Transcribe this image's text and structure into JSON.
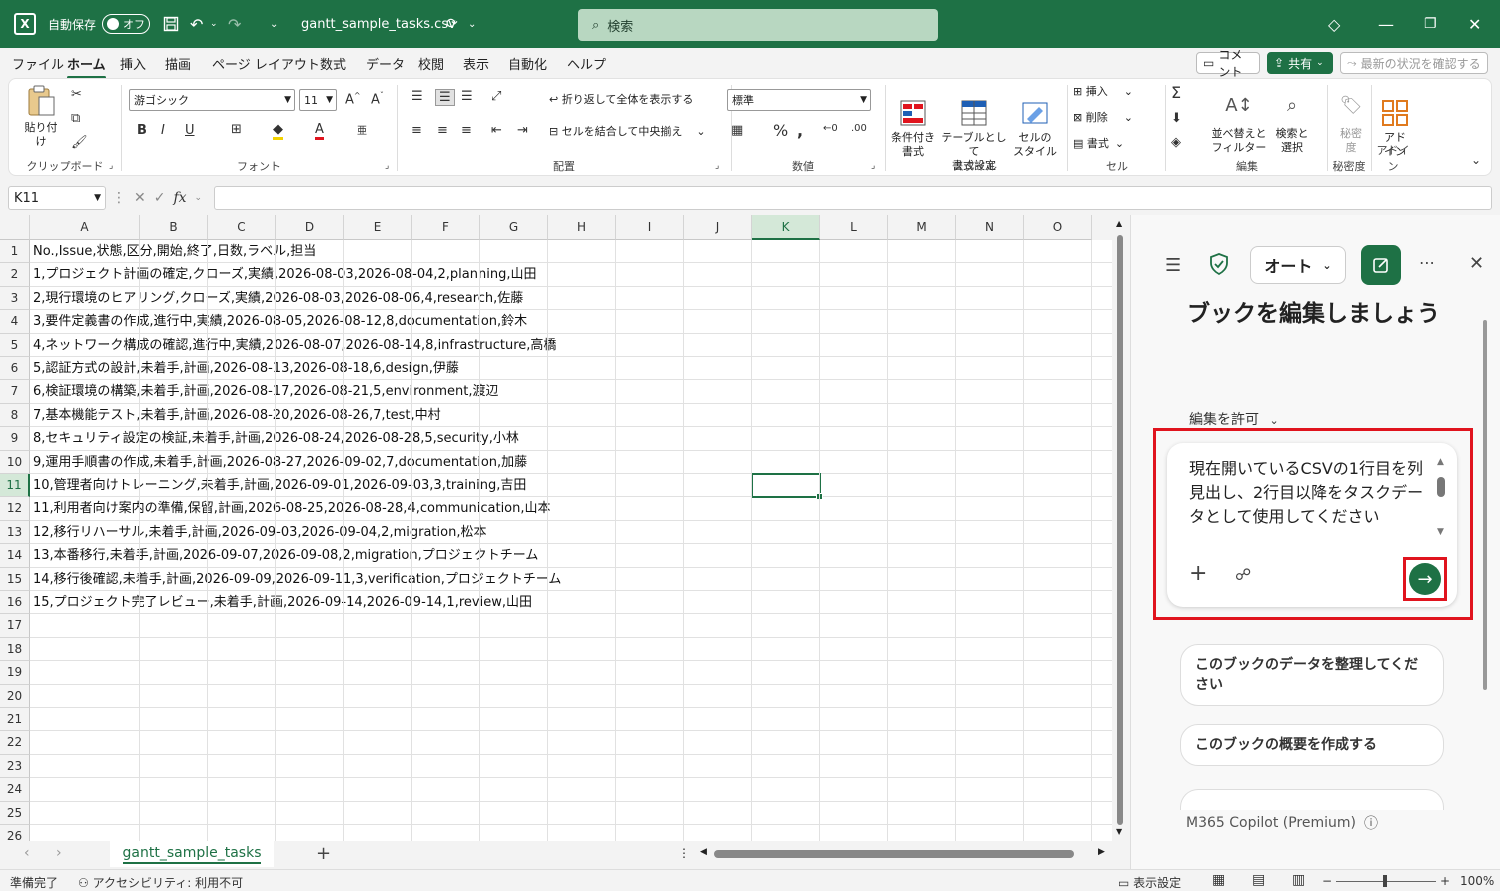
{
  "titlebar": {
    "app_letter": "X",
    "autosave_label": "自動保存",
    "autosave_state": "オフ",
    "filename": "gantt_sample_tasks.csv",
    "search_placeholder": "検索"
  },
  "menu": {
    "tabs": [
      "ファイル",
      "ホーム",
      "挿入",
      "描画",
      "ページ レイアウト",
      "数式",
      "データ",
      "校閲",
      "表示",
      "自動化",
      "ヘルプ"
    ],
    "active": "ホーム",
    "comment_btn": "コメント",
    "share_btn": "共有",
    "latest_btn": "最新の状況を確認する"
  },
  "ribbon": {
    "clipboard": {
      "paste": "貼り付け",
      "label": "クリップボード"
    },
    "font": {
      "name": "游ゴシック",
      "size": "11",
      "label": "フォント"
    },
    "align": {
      "wrap": "折り返して全体を表示する",
      "merge": "セルを結合して中央揃え",
      "label": "配置"
    },
    "number": {
      "format": "標準",
      "label": "数値"
    },
    "styles": {
      "cond": "条件付き\n書式",
      "table": "テーブルとして\n書式設定",
      "cell": "セルの\nスタイル",
      "label": "スタイル"
    },
    "cells": {
      "insert": "挿入",
      "delete": "削除",
      "format": "書式",
      "label": "セル"
    },
    "editing": {
      "sort": "並べ替えと\nフィルター",
      "find": "検索と\n選択",
      "label": "編集"
    },
    "sensitivity": {
      "btn": "秘密\n度",
      "label": "秘密度"
    },
    "addins": {
      "btn": "アド\nイン",
      "label": "アドイン"
    }
  },
  "formula": {
    "namebox": "K11",
    "fx": "fx",
    "value": ""
  },
  "grid": {
    "columns": [
      "A",
      "B",
      "C",
      "D",
      "E",
      "F",
      "G",
      "H",
      "I",
      "J",
      "K",
      "L",
      "M",
      "N",
      "O"
    ],
    "selected_col": "K",
    "selected_row": "11",
    "rows": [
      "1",
      "2",
      "3",
      "4",
      "5",
      "6",
      "7",
      "8",
      "9",
      "10",
      "11",
      "12",
      "13",
      "14",
      "15",
      "16",
      "17",
      "18",
      "19",
      "20",
      "21",
      "22",
      "23",
      "24",
      "25",
      "26"
    ],
    "cells": [
      "No.,Issue,状態,区分,開始,終了,日数,ラベル,担当",
      "1,プロジェクト計画の確定,クローズ,実績,2026-08-03,2026-08-04,2,planning,山田",
      "2,現行環境のヒアリング,クローズ,実績,2026-08-03,2026-08-06,4,research,佐藤",
      "3,要件定義書の作成,進行中,実績,2026-08-05,2026-08-12,8,documentation,鈴木",
      "4,ネットワーク構成の確認,進行中,実績,2026-08-07,2026-08-14,8,infrastructure,高橋",
      "5,認証方式の設計,未着手,計画,2026-08-13,2026-08-18,6,design,伊藤",
      "6,検証環境の構築,未着手,計画,2026-08-17,2026-08-21,5,environment,渡辺",
      "7,基本機能テスト,未着手,計画,2026-08-20,2026-08-26,7,test,中村",
      "8,セキュリティ設定の検証,未着手,計画,2026-08-24,2026-08-28,5,security,小林",
      "9,運用手順書の作成,未着手,計画,2026-08-27,2026-09-02,7,documentation,加藤",
      "10,管理者向けトレーニング,未着手,計画,2026-09-01,2026-09-03,3,training,吉田",
      "11,利用者向け案内の準備,保留,計画,2026-08-25,2026-08-28,4,communication,山本",
      "12,移行リハーサル,未着手,計画,2026-09-03,2026-09-04,2,migration,松本",
      "13,本番移行,未着手,計画,2026-09-07,2026-09-08,2,migration,プロジェクトチーム",
      "14,移行後確認,未着手,計画,2026-09-09,2026-09-11,3,verification,プロジェクトチーム",
      "15,プロジェクト完了レビュー,未着手,計画,2026-09-14,2026-09-14,1,review,山田"
    ]
  },
  "sheets": {
    "active": "gantt_sample_tasks",
    "add": "+"
  },
  "status": {
    "ready": "準備完了",
    "accessibility": "アクセシビリティ: 利用不可",
    "display_settings": "表示設定",
    "zoom": "100%"
  },
  "copilot": {
    "mode": "オート",
    "heading": "ブックを編集しましょう",
    "allow_edit": "編集を許可",
    "prompt": "現在開いているCSVの1行目を列見出し、2行目以降をタスクデータとして使用してください",
    "suggestions": [
      "このブックのデータを整理してください",
      "このブックの概要を作成する"
    ],
    "footer": "M365 Copilot (Premium)"
  },
  "colors": {
    "accent": "#1e7145",
    "highlight": "#e0141e"
  }
}
